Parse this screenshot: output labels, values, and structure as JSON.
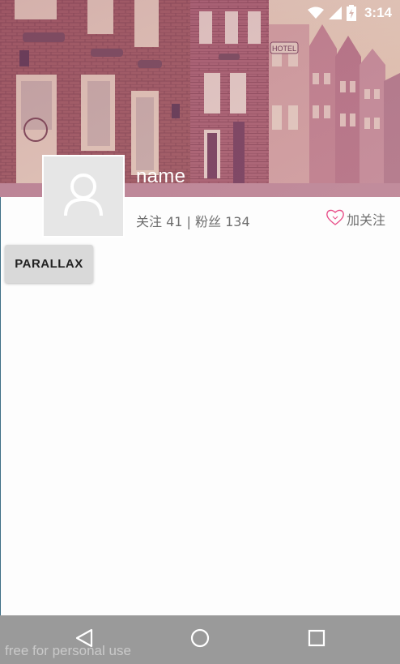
{
  "status_bar": {
    "time": "3:14",
    "icons": [
      "wifi-icon",
      "signal-icon",
      "battery-charging-icon"
    ]
  },
  "profile": {
    "name": "name",
    "stats": "关注 41 | 粉丝 134",
    "follow_label": "加关注",
    "avatar_icon": "person-placeholder-icon",
    "follow_icon": "heart-outline-icon"
  },
  "parallax_button": {
    "label": "PARALLAX"
  },
  "nav_bar": {
    "buttons": [
      "back-icon",
      "home-icon",
      "recents-icon"
    ]
  },
  "watermark": "free for personal use",
  "colors": {
    "photo_tint": "#b86a95",
    "follow_heart": "#e8508a",
    "nav_bar": "#9a9a9a",
    "button": "#d9d9d9"
  }
}
